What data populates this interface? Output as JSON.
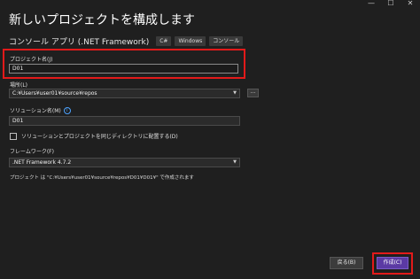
{
  "window": {
    "controls": {
      "minimize": "—",
      "maximize": "☐",
      "close": "✕"
    }
  },
  "page": {
    "title": "新しいプロジェクトを構成します",
    "template_name": "コンソール アプリ (.NET Framework)",
    "tags": [
      "C#",
      "Windows",
      "コンソール"
    ]
  },
  "form": {
    "project_name_label": "プロジェクト名(J)",
    "project_name_value": "D01",
    "location_label": "場所(L)",
    "location_value": "C:¥Users¥user01¥source¥repos",
    "browse_label": "...",
    "solution_name_label": "ソリューション名(M)",
    "solution_name_value": "D01",
    "same_dir_checkbox_label": "ソリューションとプロジェクトを同じディレクトリに配置する(D)",
    "same_dir_checked": false,
    "framework_label": "フレームワーク(F)",
    "framework_value": ".NET Framework 4.7.2",
    "path_note": "プロジェクト は \"C:¥Users¥user01¥source¥repos¥D01¥D01¥\" で作成されます"
  },
  "footer": {
    "back_label": "戻る(B)",
    "create_label": "作成(C)"
  },
  "colors": {
    "background": "#1f1f1f",
    "accent": "#5b3aa4",
    "highlight": "#e21a1a",
    "info": "#4da3ff"
  }
}
